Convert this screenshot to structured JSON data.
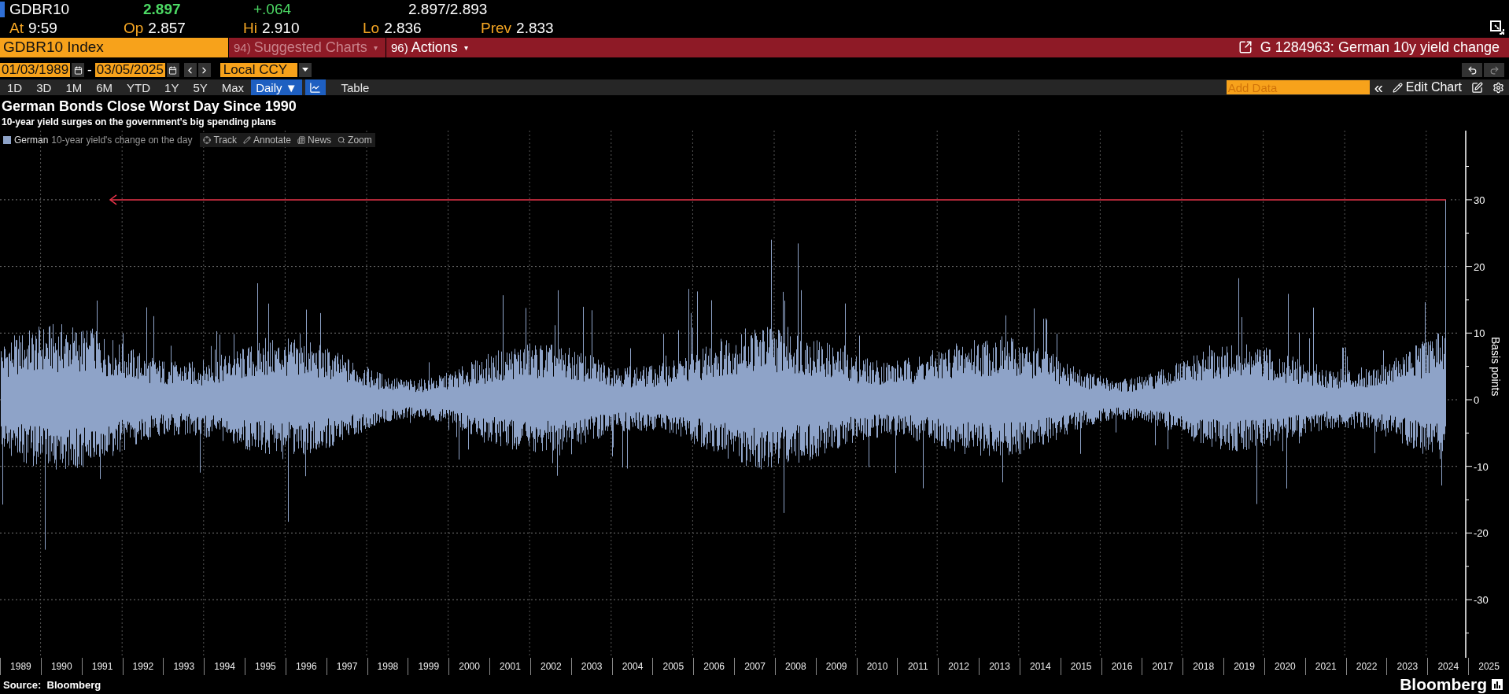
{
  "quote": {
    "ticker": "GDBR10",
    "last": "2.897",
    "change": "+.064",
    "bid_ask": "2.897/2.893"
  },
  "stats": [
    {
      "label": "At",
      "value": "9:59"
    },
    {
      "label": "Op",
      "value": "2.857"
    },
    {
      "label": "Hi",
      "value": "2.910"
    },
    {
      "label": "Lo",
      "value": "2.836"
    },
    {
      "label": "Prev",
      "value": "2.833"
    }
  ],
  "command_bar": {
    "security": "GDBR10 Index",
    "menus": [
      {
        "number": "94)",
        "label": "Suggested Charts",
        "caret": "▾",
        "disabled": true
      },
      {
        "number": "96)",
        "label": "Actions",
        "caret": "▾",
        "disabled": false
      }
    ],
    "chart_name": "G 1284963: German 10y yield change"
  },
  "range": {
    "start": "01/03/1989",
    "separator": "-",
    "end": "03/05/2025",
    "currency": "Local CCY"
  },
  "periods": [
    {
      "label": "1D",
      "selected": false
    },
    {
      "label": "3D",
      "selected": false
    },
    {
      "label": "1M",
      "selected": false
    },
    {
      "label": "6M",
      "selected": false
    },
    {
      "label": "YTD",
      "selected": false
    },
    {
      "label": "1Y",
      "selected": false
    },
    {
      "label": "5Y",
      "selected": false
    },
    {
      "label": "Max",
      "selected": false
    }
  ],
  "frequency": {
    "label": "Daily",
    "caret": "▼"
  },
  "table_button": "Table",
  "add_data": {
    "placeholder": "Add Data"
  },
  "collapse": "«",
  "edit_chart": "Edit Chart",
  "chart": {
    "title": "German Bonds Close Worst Day Since 1990",
    "subtitle": "10-year yield surges on the government's big spending plans",
    "legend": {
      "series": "German",
      "description": "10-year yield's change on the day"
    },
    "tools": [
      "Track",
      "Annotate",
      "News",
      "Zoom"
    ],
    "y_axis": {
      "label": "Basis points",
      "ticks": [
        "30",
        "20",
        "10",
        "0",
        "-10",
        "-20",
        "-30"
      ]
    },
    "x_axis": {
      "labels": [
        "1989",
        "1990",
        "1991",
        "1992",
        "1993",
        "1994",
        "1995",
        "1996",
        "1997",
        "1998",
        "1999",
        "2000",
        "2001",
        "2002",
        "2003",
        "2004",
        "2005",
        "2006",
        "2007",
        "2008",
        "2009",
        "2010",
        "2011",
        "2012",
        "2013",
        "2014",
        "2015",
        "2016",
        "2017",
        "2018",
        "2019",
        "2020",
        "2021",
        "2022",
        "2023",
        "2024",
        "2025"
      ]
    }
  },
  "footer": {
    "source": "Source:  Bloomberg",
    "brand": "Bloomberg"
  }
}
